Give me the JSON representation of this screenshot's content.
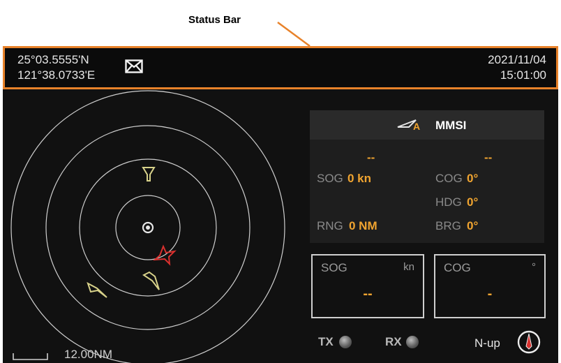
{
  "callout": {
    "label": "Status Bar"
  },
  "status_bar": {
    "latitude": "25°03.5555'N",
    "longitude": "121°38.0733'E",
    "message_icon": "envelope-icon",
    "date": "2021/11/04",
    "time": "15:01:00",
    "border_color": "#e8822a"
  },
  "target_panel": {
    "title": "MMSI",
    "title_icon": "ais-target-icon",
    "name_left": "--",
    "name_right": "--",
    "sog_label": "SOG",
    "sog_value": "0 kn",
    "cog_label": "COG",
    "cog_value": "0°",
    "hdg_label": "HDG",
    "hdg_value": "0°",
    "rng_label": "RNG",
    "rng_value": "0 NM",
    "brg_label": "BRG",
    "brg_value": "0°"
  },
  "own_ship": {
    "sog_label": "SOG",
    "sog_unit": "kn",
    "sog_value": "--",
    "cog_label": "COG",
    "cog_unit": "°",
    "cog_value": "-"
  },
  "indicators": {
    "tx_label": "TX",
    "rx_label": "RX"
  },
  "orientation": {
    "label": "N-up",
    "icon": "compass-north-icon"
  },
  "scale": {
    "label": "12.00NM"
  },
  "colors": {
    "accent": "#f0a430",
    "background": "#111111",
    "danger": "#d8302e",
    "target_yellow": "#d8d28a"
  }
}
